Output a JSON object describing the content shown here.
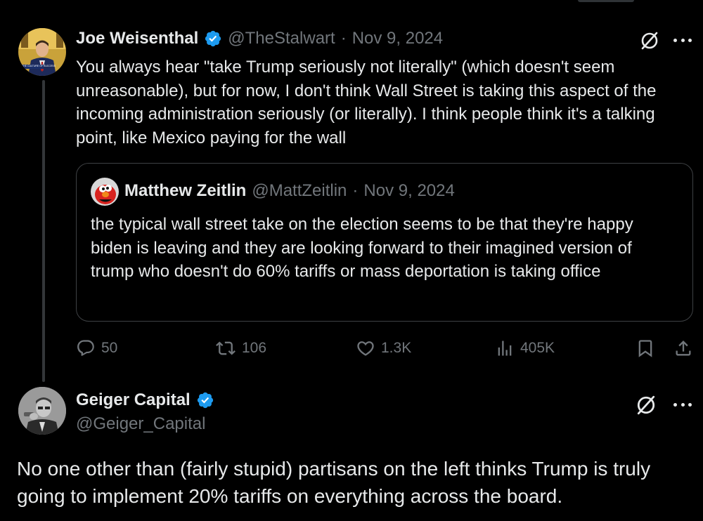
{
  "colors": {
    "background": "#000000",
    "text": "#e7e9ea",
    "muted": "#71767b",
    "verified": "#1d9bf0",
    "border": "#3e4144"
  },
  "tweet1": {
    "author_name": "Joe Weisenthal",
    "handle": "@TheStalwart",
    "separator": "·",
    "date": "Nov 9, 2024",
    "avatar_caption": "THE CULTURE OF SUCCESS",
    "text": "You always hear \"take Trump seriously not literally\" (which doesn't seem unreasonable), but for now, I don't think Wall Street is taking this aspect of the incoming administration seriously (or literally). I think people think it's a talking point, like Mexico paying for the wall",
    "quote": {
      "author_name": "Matthew Zeitlin",
      "handle": "@MattZeitlin",
      "separator": "·",
      "date": "Nov 9, 2024",
      "text": "the typical wall street take on the election seems to be that they're happy biden is leaving and they are looking forward to their imagined version of trump who doesn't do 60% tariffs or mass deportation is taking office"
    },
    "actions": {
      "replies": "50",
      "reposts": "106",
      "likes": "1.3K",
      "views": "405K"
    }
  },
  "tweet2": {
    "author_name": "Geiger Capital",
    "handle": "@Geiger_Capital",
    "text": "No one other than (fairly stupid) partisans on the left thinks Trump is truly going to implement 20% tariffs on everything across the board."
  },
  "icons": [
    "verified-badge-icon",
    "grok-slash-icon",
    "more-icon",
    "reply-icon",
    "repost-icon",
    "like-icon",
    "views-icon",
    "bookmark-icon",
    "share-icon"
  ]
}
